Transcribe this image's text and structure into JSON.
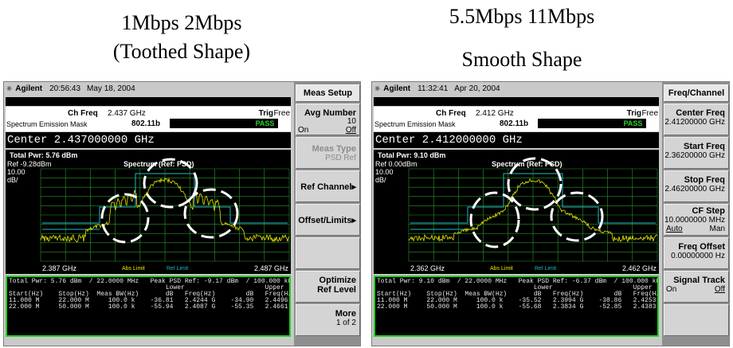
{
  "captions": {
    "left_line1": "1Mbps 2Mbps",
    "left_line2": "(Toothed Shape)",
    "right_line1": "5.5Mbps 11Mbps",
    "right_line2": "Smooth Shape"
  },
  "left": {
    "brand": "Agilent",
    "time": "20:56:43",
    "date": "May 18, 2004",
    "ch_freq_label": "Ch Freq",
    "ch_freq": "2.437 GHz",
    "trig_label": "Trig",
    "trig": "Free",
    "mode": "Spectrum Emission Mask",
    "standard": "802.11b",
    "status": "PASS",
    "center": "Center 2.437000000 GHz",
    "total_pwr": "Total Pwr:  5.76 dBm",
    "ref": "Ref -9.28dBm",
    "scale": "10.00",
    "scale_unit": "dB/",
    "spectrum_title": "Spectrum (Ref: PSD)",
    "x_start": "2.387 GHz",
    "x_stop": "2.487 GHz",
    "abs_limit": "Abs Limit",
    "rel_limit": "Rel Limit",
    "results": {
      "line1": "Total Pwr: 5.76 dBm  / 22.0000 MHz   Peak PSD Ref: -9.17 dBm  / 100.000 kHz",
      "line2": "                                         Lower                     Upper",
      "line3": "Start(Hz)    Stop(Hz)  Meas BW(Hz)       dB   Freq(Hz)        dB   Freq(Hz)",
      "line4": "11.000 M     22.000 M     100.0 k    -36.81   2.4244 G    -34.90   2.4496 G",
      "line5": "22.000 M     50.000 M     100.0 k    -55.94   2.4087 G    -55.35   2.4661 G"
    },
    "softkeys": {
      "title": "Meas Setup",
      "avg_number": "Avg Number",
      "avg_value": "10",
      "on": "On",
      "off": "Off",
      "meas_type": "Meas Type",
      "meas_type_sub": "PSD Ref",
      "ref_channel": "Ref Channel▸",
      "offset_limits": "Offset/Limits▸",
      "optimize": "Optimize",
      "ref_level": "Ref Level",
      "more": "More",
      "more_sub": "1 of 2"
    }
  },
  "right": {
    "brand": "Agilent",
    "time": "11:32:41",
    "date": "Apr 20, 2004",
    "ch_freq_label": "Ch Freq",
    "ch_freq": "2.412 GHz",
    "trig_label": "Trig",
    "trig": "Free",
    "mode": "Spectrum Emission Mask",
    "standard": "802.11b",
    "status": "PASS",
    "center": "Center 2.412000000 GHz",
    "total_pwr": "Total Pwr:  9.10 dBm",
    "ref": "Ref 0.00dBm",
    "scale": "10.00",
    "scale_unit": "dB/",
    "spectrum_title": "Spectrum (Ref: PSD)",
    "x_start": "2.362 GHz",
    "x_stop": "2.462 GHz",
    "abs_limit": "Abs Limit",
    "rel_limit": "Rel Limit",
    "results": {
      "line1": "Total Pwr: 9.10 dBm  / 22.0000 MHz   Peak PSD Ref: -6.37 dBm  / 100.000 kHz",
      "line2": "                                         Lower                     Upper",
      "line3": "Start(Hz)    Stop(Hz)  Meas BW(Hz)       dB   Freq(Hz)        dB   Freq(Hz)",
      "line4": "11.000 M     22.000 M     100.0 k    -35.52   2.3994 G    -38.86   2.4253 G",
      "line5": "22.000 M     50.000 M     100.0 k    -55.68   2.3834 G    -52.85   2.4383 G"
    },
    "softkeys": {
      "title": "Freq/Channel",
      "center_freq": "Center Freq",
      "center_freq_val": "2.41200000 GHz",
      "start_freq": "Start Freq",
      "start_freq_val": "2.36200000 GHz",
      "stop_freq": "Stop Freq",
      "stop_freq_val": "2.46200000 GHz",
      "cf_step": "CF Step",
      "cf_step_val": "10.0000000 MHz",
      "auto": "Auto",
      "man": "Man",
      "freq_offset": "Freq Offset",
      "freq_offset_val": "0.00000000  Hz",
      "signal_track": "Signal Track",
      "on": "On",
      "off": "Off"
    }
  },
  "colors": {
    "trace": "#e8e800",
    "limit": "#1fb8c8",
    "grid": "#2a9a2a",
    "pass": "#28d428"
  }
}
